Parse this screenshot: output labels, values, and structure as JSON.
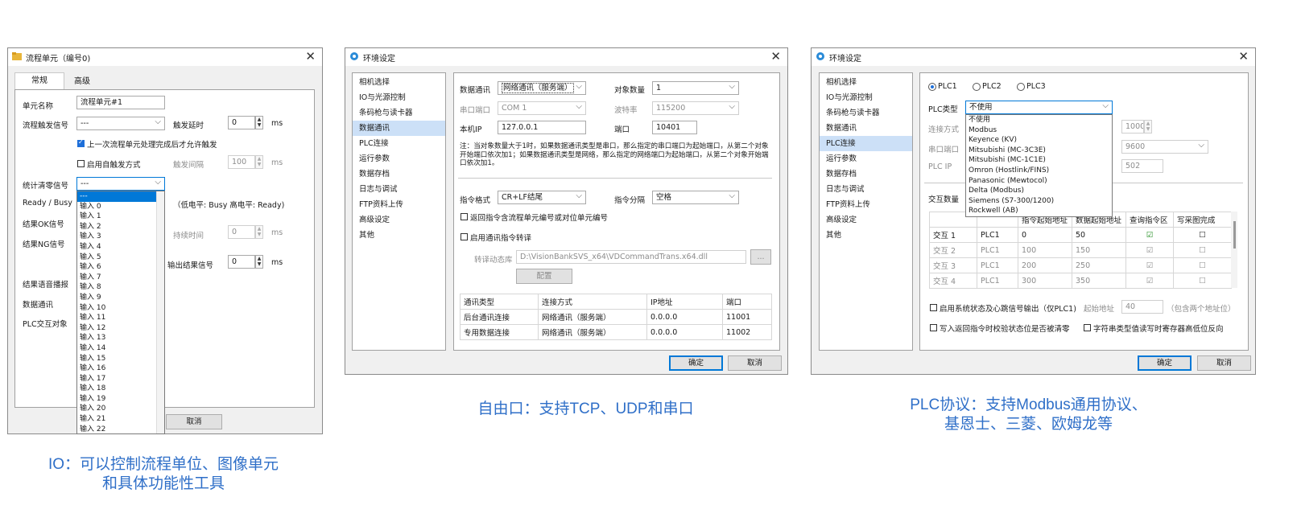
{
  "win1": {
    "title": "流程单元（编号0)",
    "close": "✕",
    "tabs": [
      "常规",
      "高级"
    ],
    "unit_name_label": "单元名称",
    "unit_name_value": "流程单元#1",
    "trigger_signal_label": "流程触发信号",
    "trigger_signal_value": "---",
    "trigger_delay_label": "触发延时",
    "trigger_delay_value": "0",
    "trigger_delay_unit": "ms",
    "allow_trigger_label": "上一次流程单元处理完成后才允许触发",
    "auto_trigger_label": "启用自触发方式",
    "trigger_interval_label": "触发间隔",
    "trigger_interval_value": "100",
    "trigger_interval_unit": "ms",
    "clear_signal_label": "统计清零信号",
    "clear_signal_value": "---",
    "ready_label": "Ready / Busy",
    "ready_note": "（低电平: Busy  高电平: Ready)",
    "ok_label": "结果OK信号",
    "hold_label": "持续时间",
    "hold_value": "0",
    "hold_unit": "ms",
    "ng_label": "结果NG信号",
    "output_label": "输出结果信号",
    "output_value": "0",
    "output_unit": "ms",
    "voice_label": "结果语音播报",
    "comm_label": "数据通讯",
    "plc_label": "PLC交互对象",
    "cancel": "取消",
    "dropdown_items": [
      "---",
      "输入 0",
      "输入 1",
      "输入 2",
      "输入 3",
      "输入 4",
      "输入 5",
      "输入 6",
      "输入 7",
      "输入 8",
      "输入 9",
      "输入 10",
      "输入 11",
      "输入 12",
      "输入 13",
      "输入 14",
      "输入 15",
      "输入 16",
      "输入 17",
      "输入 18",
      "输入 19",
      "输入 20",
      "输入 21",
      "输入 22"
    ]
  },
  "win2": {
    "title": "环境设定",
    "close": "✕",
    "nav": [
      "相机选择",
      "IO与光源控制",
      "条码枪与读卡器",
      "数据通讯",
      "PLC连接",
      "运行参数",
      "数据存档",
      "日志与调试",
      "FTP资料上传",
      "高级设定",
      "其他"
    ],
    "comm_label": "数据通讯",
    "comm_value": "网络通讯（服务端）",
    "count_label": "对象数量",
    "count_value": "1",
    "port_label": "串口端口",
    "port_value": "COM 1",
    "baud_label": "波特率",
    "baud_value": "115200",
    "ip_label": "本机IP",
    "ip_value": "127.0.0.1",
    "netport_label": "端口",
    "netport_value": "10401",
    "note": "注：当对象数量大于1时，如果数据通讯类型是串口，那么指定的串口端口为起始端口，从第二个对象开始端口依次加1；如果数据通讯类型是网络，那么指定的网络端口为起始端口，从第二个对象开始端口依次加1。",
    "fmt_label": "指令格式",
    "fmt_value": "CR+LF结尾",
    "sep_label": "指令分隔",
    "sep_value": "空格",
    "return_label": "返回指令含流程单元编号或对位单元编号",
    "translate_label": "启用通讯指令转译",
    "lib_label": "转译动态库",
    "lib_value": "D:\\VisionBankSVS_x64\\VDCommandTrans.x64.dll",
    "browse": "...",
    "config": "配置",
    "table_headers": [
      "通讯类型",
      "连接方式",
      "IP地址",
      "端口"
    ],
    "table_rows": [
      [
        "后台通讯连接",
        "网络通讯（服务端）",
        "0.0.0.0",
        "11001"
      ],
      [
        "专用数据连接",
        "网络通讯（服务端）",
        "0.0.0.0",
        "11002"
      ]
    ],
    "ok": "确定",
    "cancel": "取消"
  },
  "win3": {
    "title": "环境设定",
    "close": "✕",
    "nav": [
      "相机选择",
      "IO与光源控制",
      "条码枪与读卡器",
      "数据通讯",
      "PLC连接",
      "运行参数",
      "数据存档",
      "日志与调试",
      "FTP资料上传",
      "高级设定",
      "其他"
    ],
    "radios": [
      "PLC1",
      "PLC2",
      "PLC3"
    ],
    "type_label": "PLC类型",
    "type_value": "不使用",
    "conn_label": "连接方式",
    "serial_label": "串口端口",
    "ip_label": "PLC IP",
    "right_val1": "1000",
    "right_val2": "9600",
    "right_val3": "502",
    "interact_label": "交互数量",
    "dropdown_items": [
      "不使用",
      "Modbus",
      "Keyence (KV)",
      "Mitsubishi (MC-3C3E)",
      "Mitsubishi (MC-1C1E)",
      "Omron (Hostlink/FINS)",
      "Panasonic (Mewtocol)",
      "Delta (Modbus)",
      "Siemens (S7-300/1200)",
      "Rockwell (AB)"
    ],
    "table_headers": [
      "",
      "",
      "指令起始地址",
      "数据起始地址",
      "查询指令区",
      "写采图完成"
    ],
    "table_rows": [
      [
        "交互 1",
        "PLC1",
        "0",
        "50"
      ],
      [
        "交互 2",
        "PLC1",
        "100",
        "150"
      ],
      [
        "交互 3",
        "PLC1",
        "200",
        "250"
      ],
      [
        "交互 4",
        "PLC1",
        "300",
        "350"
      ]
    ],
    "heartbeat_label": "启用系统状态及心跳信号输出（仅PLC1)",
    "start_addr_label": "起始地址",
    "start_addr_value": "40",
    "start_addr_note": "（包含两个地址位）",
    "verify_label": "写入返回指令时校验状态位是否被清零",
    "string_label": "字符串类型值读写时寄存器高低位反向",
    "ok": "确定",
    "cancel": "取消"
  },
  "captions": {
    "c1_line1": "IO：可以控制流程单位、图像单元",
    "c1_line2": "和具体功能性工具",
    "c2": "自由口：支持TCP、UDP和串口",
    "c3_line1": "PLC协议：支持Modbus通用协议、",
    "c3_line2": "基恩士、三菱、欧姆龙等"
  },
  "colors": {
    "caption": "#2f6fc8",
    "accent": "#0078d7",
    "nav_active": "#cce0f7"
  }
}
